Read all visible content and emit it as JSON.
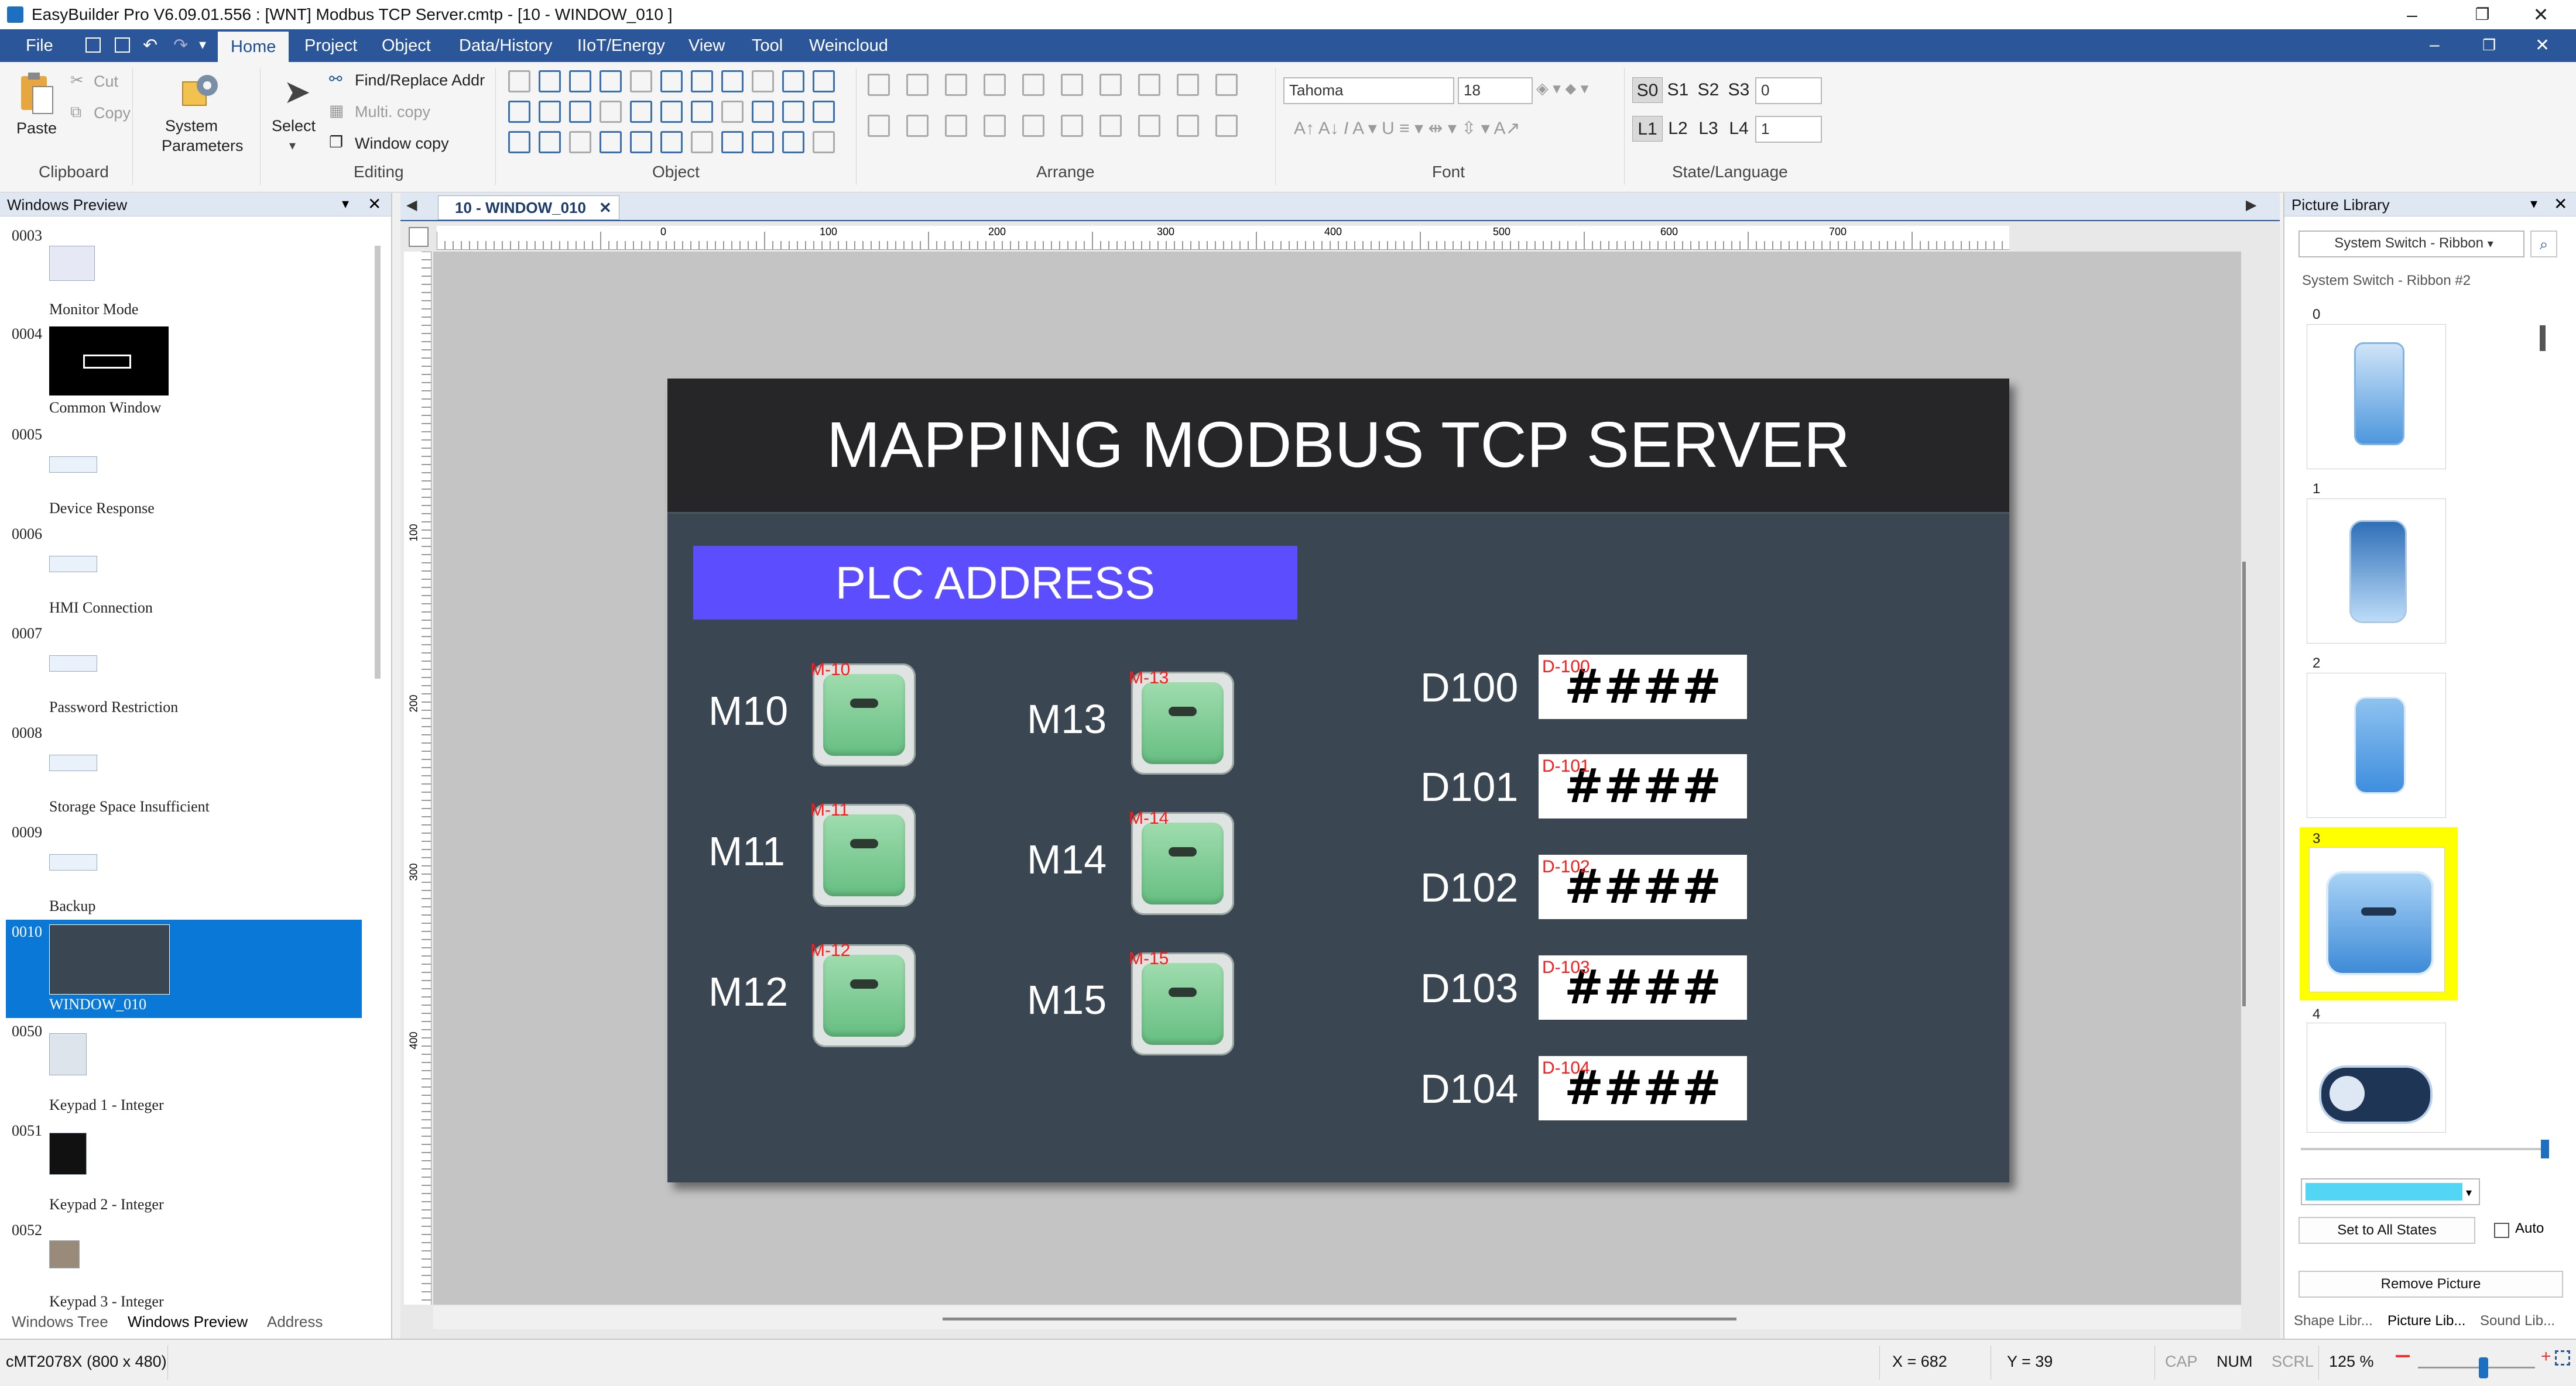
{
  "app": {
    "title": "EasyBuilder Pro V6.09.01.556 : [WNT] Modbus TCP Server.cmtp - [10 - WINDOW_010 ]",
    "window_controls": [
      "–",
      "❐",
      "✕"
    ],
    "inner_controls": [
      "–",
      "❐",
      "✕"
    ]
  },
  "ribbon": {
    "tabs": [
      "File",
      "Home",
      "Project",
      "Object",
      "Data/History",
      "IIoT/Energy",
      "View",
      "Tool",
      "Weincloud"
    ],
    "active_tab": "Home",
    "clipboard": {
      "paste": "Paste",
      "cut": "Cut",
      "copy": "Copy",
      "group": "Clipboard"
    },
    "system": {
      "label_1": "System",
      "label_2": "Parameters"
    },
    "editing": {
      "select": "Select",
      "find_replace": "Find/Replace Addr",
      "multi_copy": "Multi. copy",
      "window_copy": "Window copy",
      "group": "Editing"
    },
    "object_group": "Object",
    "arrange_group": "Arrange",
    "font": {
      "family": "Tahoma",
      "size": "18",
      "group": "Font"
    },
    "state": {
      "buttons": [
        "S0",
        "S1",
        "S2",
        "S3"
      ],
      "state_value": "0",
      "lang_buttons": [
        "L1",
        "L2",
        "L3",
        "L4"
      ],
      "lang_value": "1",
      "group": "State/Language"
    }
  },
  "left_panel": {
    "title": "Windows Preview",
    "items": [
      {
        "num": "0003",
        "name": "Monitor Mode"
      },
      {
        "num": "0004",
        "name": "Common Window"
      },
      {
        "num": "0005",
        "name": "Device Response"
      },
      {
        "num": "0006",
        "name": "HMI Connection"
      },
      {
        "num": "0007",
        "name": "Password Restriction"
      },
      {
        "num": "0008",
        "name": "Storage Space Insufficient"
      },
      {
        "num": "0009",
        "name": "Backup"
      },
      {
        "num": "0010",
        "name": "WINDOW_010"
      },
      {
        "num": "0050",
        "name": "Keypad 1 - Integer"
      },
      {
        "num": "0051",
        "name": "Keypad 2 - Integer"
      },
      {
        "num": "0052",
        "name": "Keypad 3 - Integer"
      }
    ],
    "bottom_tabs": [
      "Windows Tree",
      "Windows Preview",
      "Address"
    ],
    "active_bottom_tab": "Windows Preview"
  },
  "editor": {
    "tab": "10 - WINDOW_010",
    "ruler_h": [
      "0",
      "100",
      "200",
      "300",
      "400",
      "500",
      "600",
      "700"
    ],
    "ruler_v": [
      "100",
      "200",
      "300",
      "400"
    ]
  },
  "hmi": {
    "title": "MAPPING MODBUS TCP SERVER",
    "plc_address": "PLC ADDRESS",
    "switches": [
      {
        "label": "M10",
        "addr": "M-10"
      },
      {
        "label": "M11",
        "addr": "M-11"
      },
      {
        "label": "M12",
        "addr": "M-12"
      },
      {
        "label": "M13",
        "addr": "M-13"
      },
      {
        "label": "M14",
        "addr": "M-14"
      },
      {
        "label": "M15",
        "addr": "M-15"
      }
    ],
    "registers": [
      {
        "label": "D100",
        "addr": "D-100",
        "value": "####"
      },
      {
        "label": "D101",
        "addr": "D-101",
        "value": "####"
      },
      {
        "label": "D102",
        "addr": "D-102",
        "value": "####"
      },
      {
        "label": "D103",
        "addr": "D-103",
        "value": "####"
      },
      {
        "label": "D104",
        "addr": "D-104",
        "value": "####"
      }
    ]
  },
  "right_panel": {
    "title": "Picture Library",
    "dropdown": "System Switch - Ribbon",
    "subtitle": "System Switch - Ribbon #2",
    "items": [
      "0",
      "1",
      "2",
      "3",
      "4"
    ],
    "selected_item": "3",
    "set_all_states": "Set to All States",
    "auto": "Auto",
    "remove_picture": "Remove Picture",
    "bottom_tabs": [
      "Shape Libr...",
      "Picture Lib...",
      "Sound Lib..."
    ]
  },
  "status_bar": {
    "model": "cMT2078X (800 x 480)",
    "x": "X = 682",
    "y": "Y = 39",
    "cap": "CAP",
    "num": "NUM",
    "scrl": "SCRL",
    "zoom": "125 %"
  },
  "colors": {
    "ribbon_blue": "#2b579a",
    "hmi_bg": "#3a4651",
    "hmi_title_bg": "#262628",
    "plc_bar": "#5c4dff",
    "selected_blue": "#0a78d7",
    "highlight_yellow": "#ffff00",
    "address_red": "#ff1a1a"
  }
}
